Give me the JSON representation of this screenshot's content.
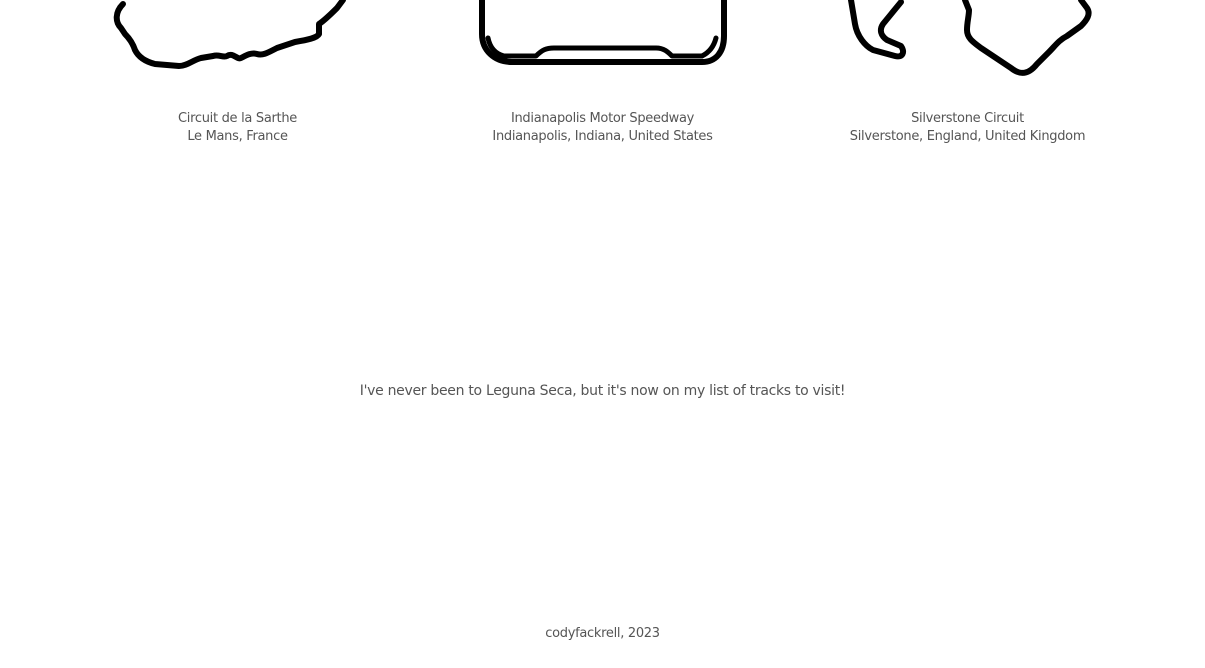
{
  "tracks": [
    {
      "name": "Circuit de la Sarthe",
      "location": "Le Mans, France"
    },
    {
      "name": "Indianapolis Motor Speedway",
      "location": "Indianapolis, Indiana, United States"
    },
    {
      "name": "Silverstone Circuit",
      "location": "Silverstone, England, United Kingdom"
    }
  ],
  "message": "I've never been to Leguna Seca, but it's now on my list of tracks to visit!",
  "footer": "codyfackrell, 2023",
  "colors": {
    "track_stroke": "#000000",
    "text": "#555555",
    "background": "#ffffff"
  }
}
